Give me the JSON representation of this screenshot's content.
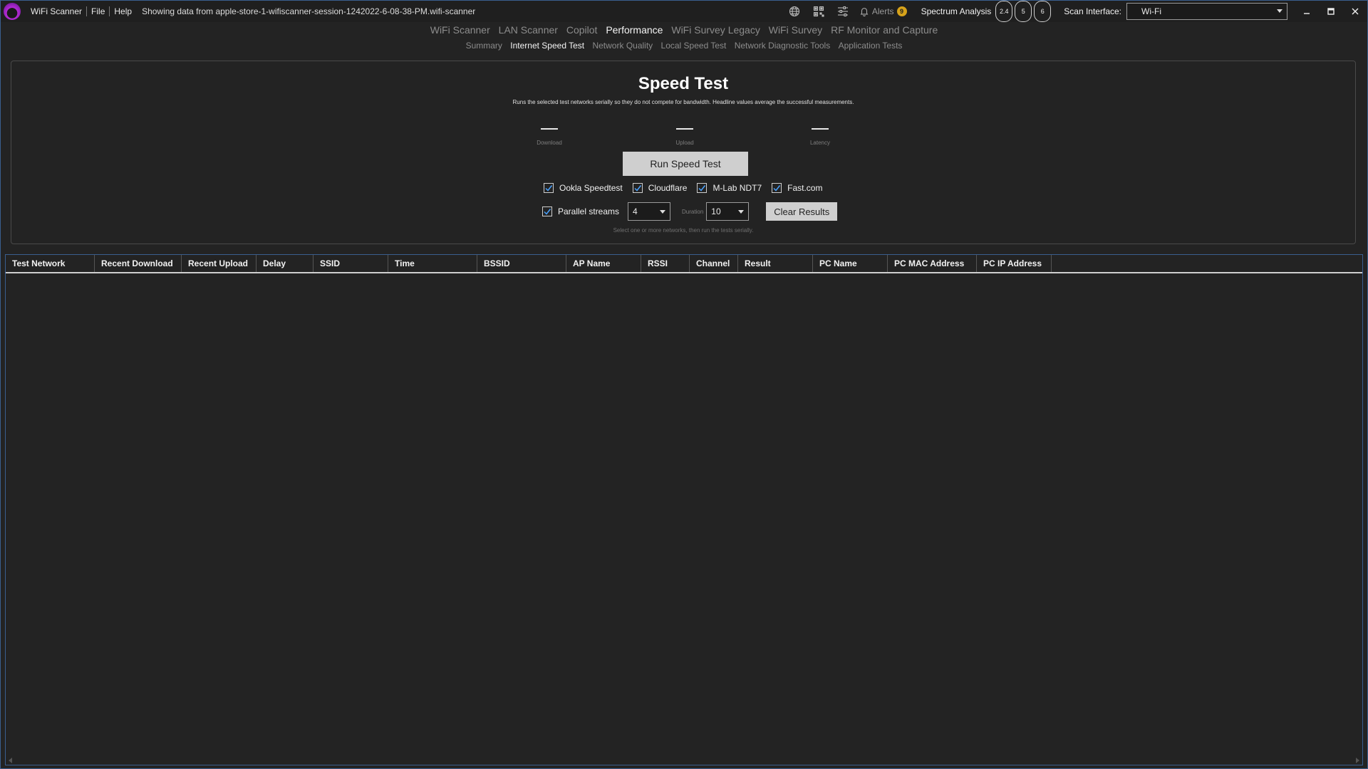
{
  "titlebar": {
    "app_name": "WiFi Scanner",
    "menu": [
      "File",
      "Help"
    ],
    "file_info": "Showing data from apple-store-1-wifiscanner-session-1242022-6-08-38-PM.wifi-scanner",
    "alerts_label": "Alerts",
    "alerts_count": "9",
    "spectrum_label": "Spectrum Analysis",
    "bands": [
      "2.4",
      "5",
      "6"
    ],
    "scan_interface_label": "Scan Interface:",
    "scan_interface_value": "Wi-Fi",
    "icons": [
      "globe-icon",
      "qr-grid-icon",
      "sliders-icon",
      "bell-icon"
    ],
    "accent_color": "#d6a21a"
  },
  "nav": {
    "main_tabs": [
      "WiFi Scanner",
      "LAN Scanner",
      "Copilot",
      "Performance",
      "WiFi Survey Legacy",
      "WiFi Survey",
      "RF Monitor and Capture"
    ],
    "main_active": "Performance",
    "sub_tabs": [
      "Summary",
      "Internet Speed Test",
      "Network Quality",
      "Local Speed Test",
      "Network Diagnostic Tools",
      "Application Tests"
    ],
    "sub_active": "Internet Speed Test"
  },
  "speedtest": {
    "title": "Speed Test",
    "description": "Runs the selected test networks serially so they do not compete for bandwidth. Headline values average the successful measurements.",
    "metrics": [
      {
        "label": "Download",
        "value": "—"
      },
      {
        "label": "Upload",
        "value": "—"
      },
      {
        "label": "Latency",
        "value": "—"
      }
    ],
    "run_button": "Run Speed Test",
    "providers": [
      {
        "label": "Ookla Speedtest",
        "checked": true
      },
      {
        "label": "Cloudflare",
        "checked": true
      },
      {
        "label": "M-Lab NDT7",
        "checked": true
      },
      {
        "label": "Fast.com",
        "checked": true
      }
    ],
    "parallel_label": "Parallel streams",
    "parallel_checked": true,
    "parallel_value": "4",
    "duration_label": "Duration",
    "duration_value": "10",
    "clear_button": "Clear Results",
    "hint": "Select one or more networks, then run the tests serially."
  },
  "results_table": {
    "columns": [
      "Test Network",
      "Recent Download",
      "Recent Upload",
      "Delay",
      "SSID",
      "Time",
      "BSSID",
      "AP Name",
      "RSSI",
      "Channel",
      "Result",
      "PC Name",
      "PC MAC Address",
      "PC IP Address"
    ],
    "rows": []
  }
}
